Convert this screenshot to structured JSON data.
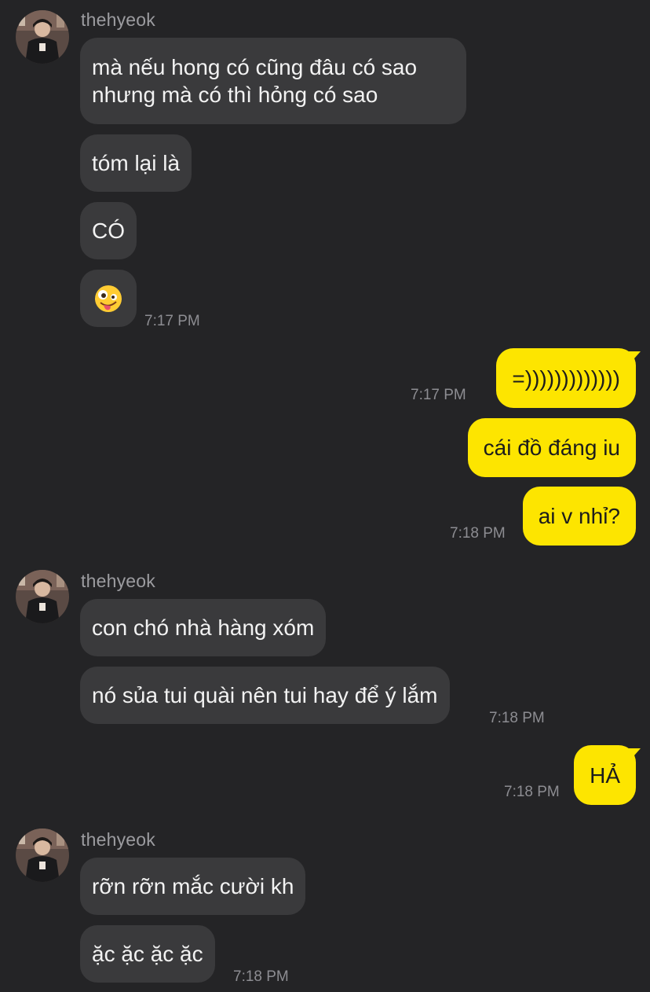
{
  "contact": {
    "name": "thehyeok"
  },
  "messages": [
    {
      "id": "m1",
      "from": "them",
      "lines": [
        "mà nếu hong có cũng đâu có sao",
        "nhưng mà có thì hỏng có sao"
      ]
    },
    {
      "id": "m2",
      "from": "them",
      "text": "tóm lại là"
    },
    {
      "id": "m3",
      "from": "them",
      "text": "CÓ"
    },
    {
      "id": "m4",
      "from": "them",
      "emoji": "zany-face-emoji",
      "time": "7:17 PM"
    },
    {
      "id": "m5",
      "from": "me",
      "text": "=)))))))))))))",
      "time": "7:17 PM"
    },
    {
      "id": "m6",
      "from": "me",
      "text": "cái đồ đáng iu"
    },
    {
      "id": "m7",
      "from": "me",
      "text": "ai v nhỉ?",
      "time": "7:18 PM"
    },
    {
      "id": "m8",
      "from": "them",
      "text": "con chó nhà hàng xóm"
    },
    {
      "id": "m9",
      "from": "them",
      "text": "nó sủa tui quài nên tui hay để ý lắm",
      "time": "7:18 PM"
    },
    {
      "id": "m10",
      "from": "me",
      "text": "HẢ",
      "time": "7:18 PM"
    },
    {
      "id": "m11",
      "from": "them",
      "text": "rỡn rỡn mắc cười kh"
    },
    {
      "id": "m12",
      "from": "them",
      "text": "ặc ặc ặc ặc",
      "time": "7:18 PM"
    }
  ],
  "colors": {
    "background": "#242426",
    "incoming_bubble": "#3a3a3c",
    "outgoing_bubble": "#fde500",
    "timestamp": "#8d8d92"
  }
}
